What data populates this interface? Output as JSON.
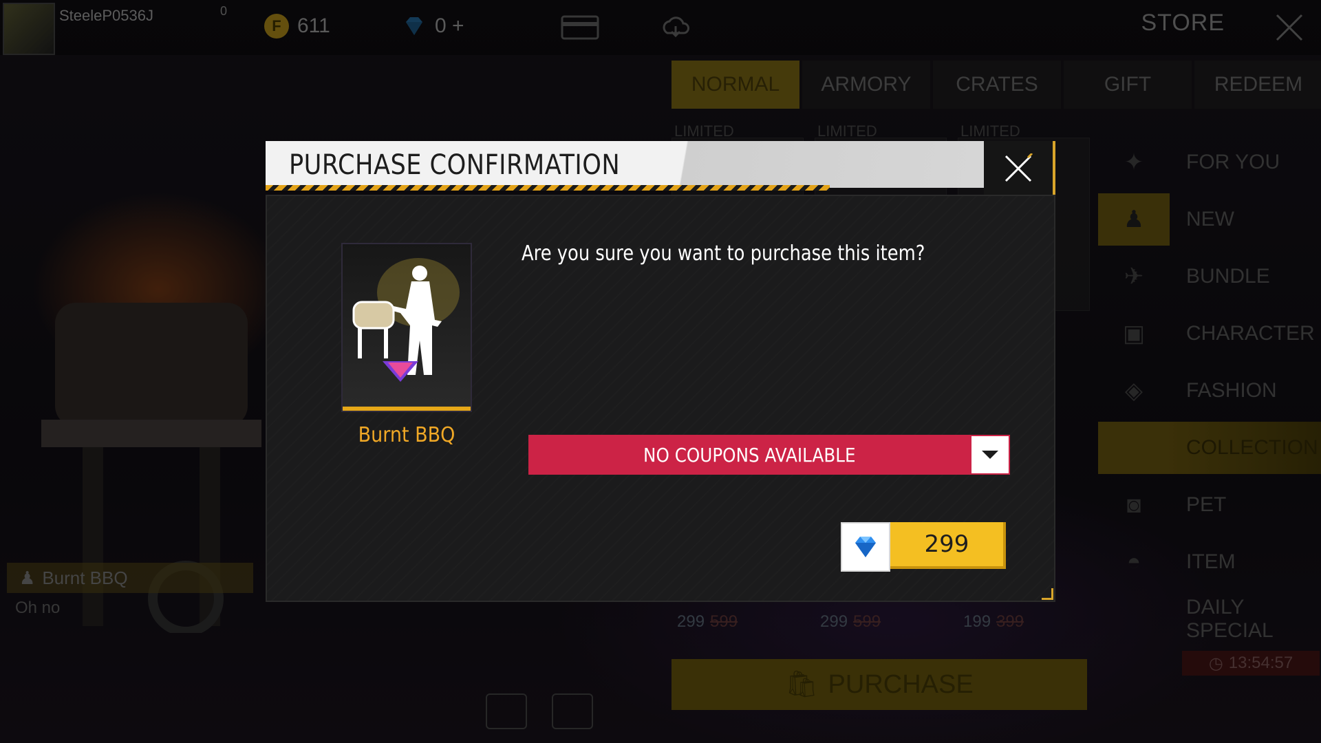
{
  "player": {
    "name": "SteeleP0536J",
    "level_badge": "0"
  },
  "currencies": [
    {
      "icon": "gold-coin-icon",
      "value": "611"
    },
    {
      "icon": "diamond-icon",
      "value": "0 +"
    }
  ],
  "store": {
    "title": "STORE"
  },
  "tabs": [
    "NORMAL",
    "ARMORY",
    "CRATES",
    "GIFT",
    "REDEEM"
  ],
  "active_tab": "NORMAL",
  "sidebar": {
    "items": [
      "FOR YOU",
      "NEW",
      "BUNDLE",
      "CHARACTER",
      "FASHION",
      "COLLECTION",
      "PET",
      "ITEM",
      "DAILY SPECIAL"
    ],
    "active": "COLLECTION",
    "timer": "13:54:57"
  },
  "cards": {
    "limited_label": "LIMITED",
    "prices": [
      {
        "price": "299",
        "original": "599"
      },
      {
        "price": "299",
        "original": "599"
      },
      {
        "price": "199",
        "original": "399"
      }
    ]
  },
  "preview": {
    "item_name": "Burnt BBQ",
    "subtitle": "Oh no"
  },
  "bottom": {
    "purchase_label": "PURCHASE"
  },
  "modal": {
    "title": "PURCHASE CONFIRMATION",
    "question": "Are you sure you want to purchase this item?",
    "item_name": "Burnt BBQ",
    "coupon_label": "NO COUPONS AVAILABLE",
    "price": "299",
    "price_currency_icon": "diamond-icon",
    "accent_color": "#f4bf22",
    "coupon_color": "#cc2346"
  }
}
